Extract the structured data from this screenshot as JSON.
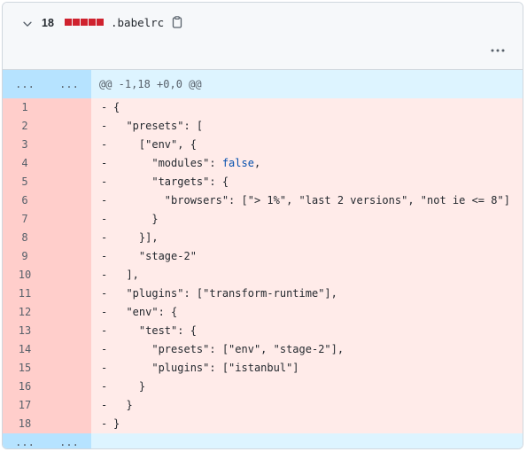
{
  "file": {
    "changes_count": "18",
    "diffstat_blocks": 5,
    "name": ".babelrc",
    "deletion_color": "#cf222e"
  },
  "icons": {
    "collapse": "chevron-down-icon",
    "copy": "copy-icon",
    "more": "kebab-horizontal-icon"
  },
  "hunk": {
    "expand_label": "...",
    "header": "@@ -1,18 +0,0 @@"
  },
  "lines": [
    {
      "num": "1",
      "marker": "-",
      "code": "{"
    },
    {
      "num": "2",
      "marker": "-",
      "code": "  \"presets\": ["
    },
    {
      "num": "3",
      "marker": "-",
      "code": "    [\"env\", {"
    },
    {
      "num": "4",
      "marker": "-",
      "code": "      \"modules\": ",
      "keyword": "false",
      "after": ","
    },
    {
      "num": "5",
      "marker": "-",
      "code": "      \"targets\": {"
    },
    {
      "num": "6",
      "marker": "-",
      "code": "        \"browsers\": [\"> 1%\", \"last 2 versions\", \"not ie <= 8\"]"
    },
    {
      "num": "7",
      "marker": "-",
      "code": "      }"
    },
    {
      "num": "8",
      "marker": "-",
      "code": "    }],"
    },
    {
      "num": "9",
      "marker": "-",
      "code": "    \"stage-2\""
    },
    {
      "num": "10",
      "marker": "-",
      "code": "  ],"
    },
    {
      "num": "11",
      "marker": "-",
      "code": "  \"plugins\": [\"transform-runtime\"],"
    },
    {
      "num": "12",
      "marker": "-",
      "code": "  \"env\": {"
    },
    {
      "num": "13",
      "marker": "-",
      "code": "    \"test\": {"
    },
    {
      "num": "14",
      "marker": "-",
      "code": "      \"presets\": [\"env\", \"stage-2\"],"
    },
    {
      "num": "15",
      "marker": "-",
      "code": "      \"plugins\": [\"istanbul\"]"
    },
    {
      "num": "16",
      "marker": "-",
      "code": "    }"
    },
    {
      "num": "17",
      "marker": "-",
      "code": "  }"
    },
    {
      "num": "18",
      "marker": "-",
      "code": "}"
    }
  ]
}
